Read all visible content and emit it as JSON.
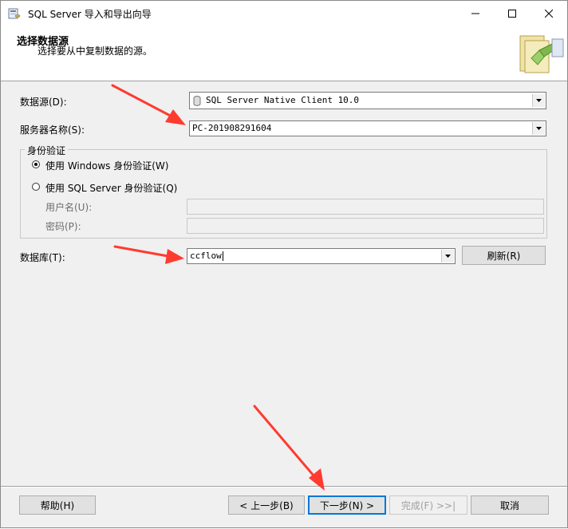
{
  "window": {
    "title": "SQL Server 导入和导出向导"
  },
  "header": {
    "title": "选择数据源",
    "subtitle": "选择要从中复制数据的源。"
  },
  "form": {
    "datasource_label": "数据源(D):",
    "datasource_value": "SQL Server Native Client 10.0",
    "server_label": "服务器名称(S):",
    "server_value": "PC-201908291604",
    "auth_group_label": "身份验证",
    "auth_windows_label": "使用 Windows 身份验证(W)",
    "auth_sql_label": "使用 SQL Server 身份验证(Q)",
    "username_label": "用户名(U):",
    "password_label": "密码(P):",
    "database_label": "数据库(T):",
    "database_value": "ccflow",
    "refresh_label": "刷新(R)"
  },
  "footer": {
    "help_label": "帮助(H)",
    "back_label": "< 上一步(B)",
    "next_label": "下一步(N) >",
    "finish_label": "完成(F) >>|",
    "cancel_label": "取消"
  },
  "colors": {
    "annotation_arrow": "#ff3b30",
    "focus_border": "#0078d7"
  },
  "icons": {
    "app": "database-wizard-icon",
    "header": "data-transfer-icon"
  }
}
